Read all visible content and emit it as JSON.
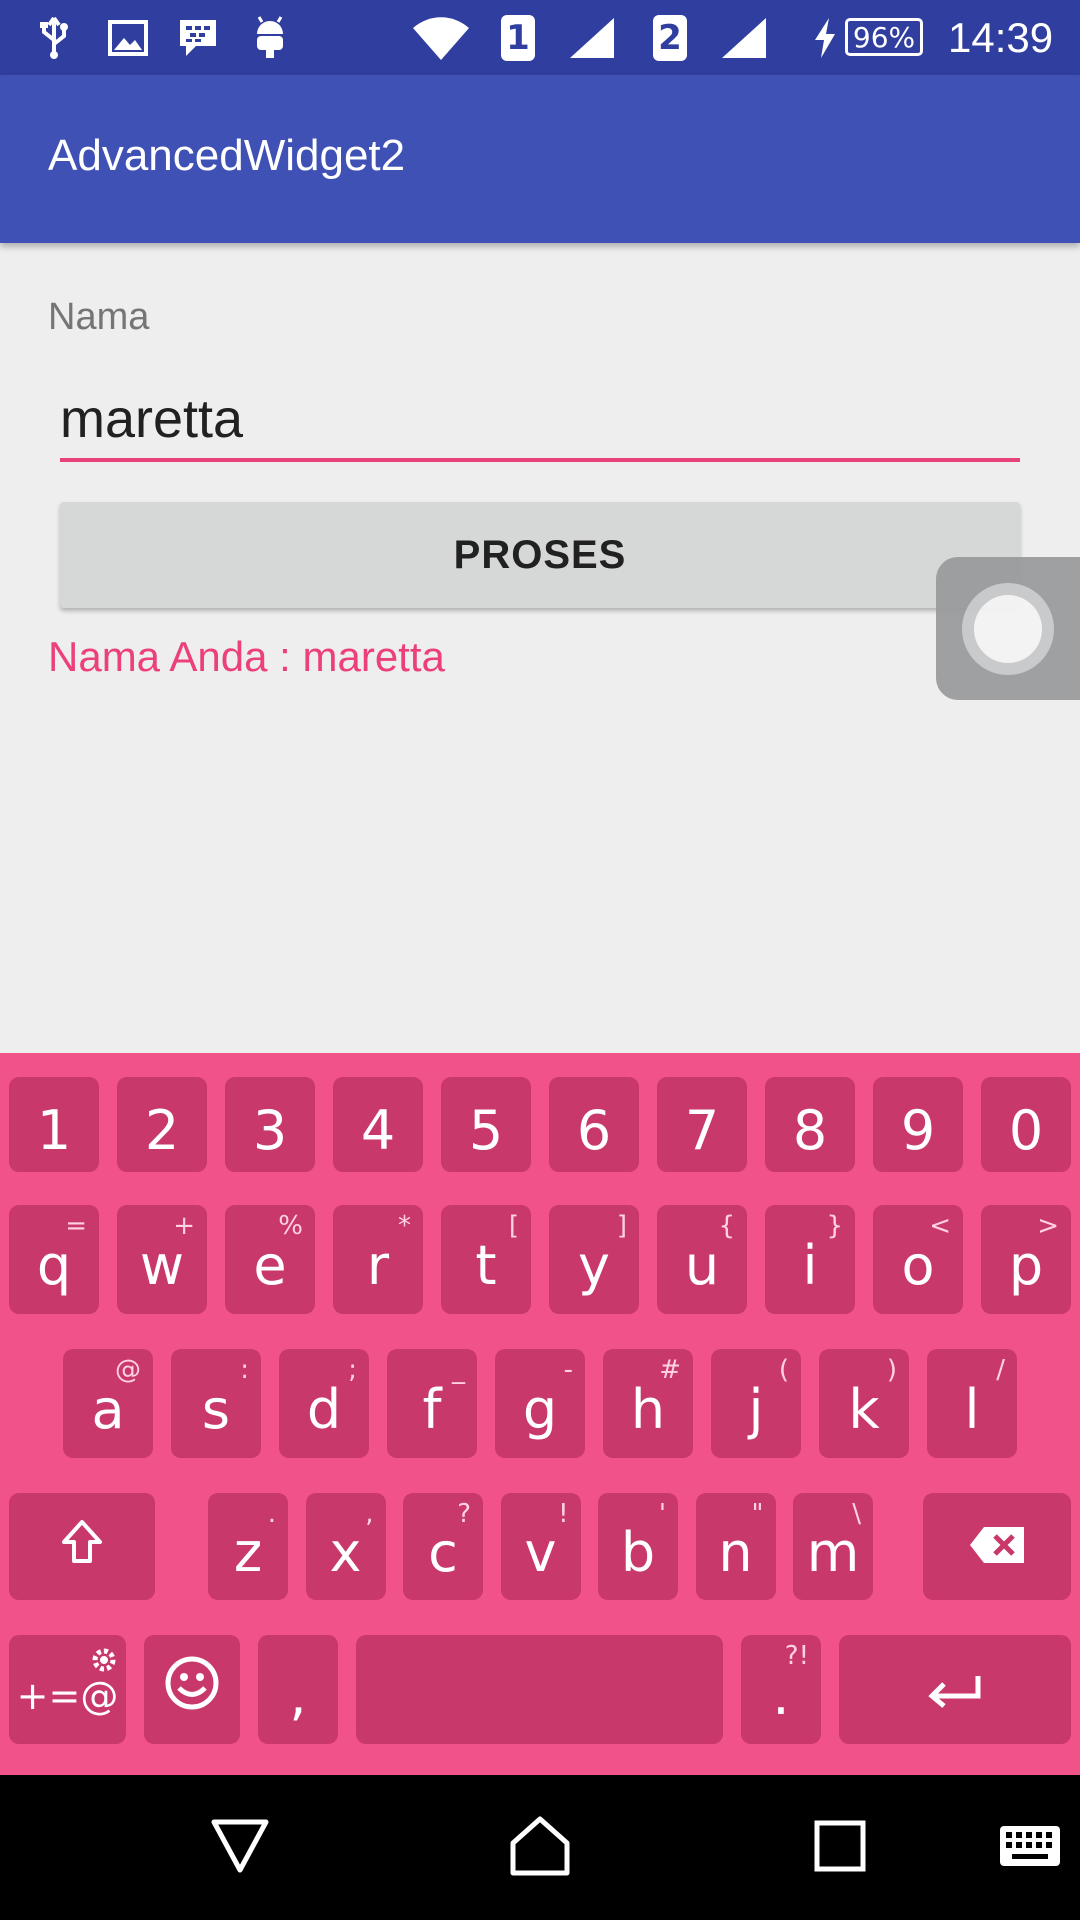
{
  "status_bar": {
    "sim1": "1",
    "sim2": "2",
    "battery": "96%",
    "time": "14:39",
    "icons": [
      "usb-icon",
      "image-icon",
      "bbm-icon",
      "android-icon",
      "wifi-icon",
      "signal-icon",
      "charging-icon"
    ]
  },
  "app": {
    "title": "AdvancedWidget2"
  },
  "form": {
    "label": "Nama",
    "input_value": "maretta",
    "button_label": "PROSES",
    "result": "Nama Anda : maretta"
  },
  "keyboard": {
    "row1": [
      "1",
      "2",
      "3",
      "4",
      "5",
      "6",
      "7",
      "8",
      "9",
      "0"
    ],
    "row2": [
      [
        "q",
        "="
      ],
      [
        "w",
        "+"
      ],
      [
        "e",
        "%"
      ],
      [
        "r",
        "*"
      ],
      [
        "t",
        "["
      ],
      [
        "y",
        "]"
      ],
      [
        "u",
        "{"
      ],
      [
        "i",
        "}"
      ],
      [
        "o",
        "<"
      ],
      [
        "p",
        ">"
      ]
    ],
    "row3": [
      [
        "a",
        "@"
      ],
      [
        "s",
        ":"
      ],
      [
        "d",
        ";"
      ],
      [
        "f",
        "_"
      ],
      [
        "g",
        "-"
      ],
      [
        "h",
        "#"
      ],
      [
        "j",
        "("
      ],
      [
        "k",
        ")"
      ],
      [
        "l",
        "/"
      ]
    ],
    "row4": [
      [
        "z",
        "."
      ],
      [
        "x",
        ","
      ],
      [
        "c",
        "?"
      ],
      [
        "v",
        "!"
      ],
      [
        "b",
        "'"
      ],
      [
        "n",
        "\""
      ],
      [
        "m",
        "\\"
      ]
    ],
    "symbols_label": "+=@",
    "comma": ",",
    "period": ".",
    "period_alt": "?!"
  },
  "colors": {
    "status_bar": "#303f9f",
    "app_bar": "#3f51b5",
    "accent": "#ec407a",
    "keyboard_bg": "#f2528a",
    "key_bg": "#c9386b"
  }
}
